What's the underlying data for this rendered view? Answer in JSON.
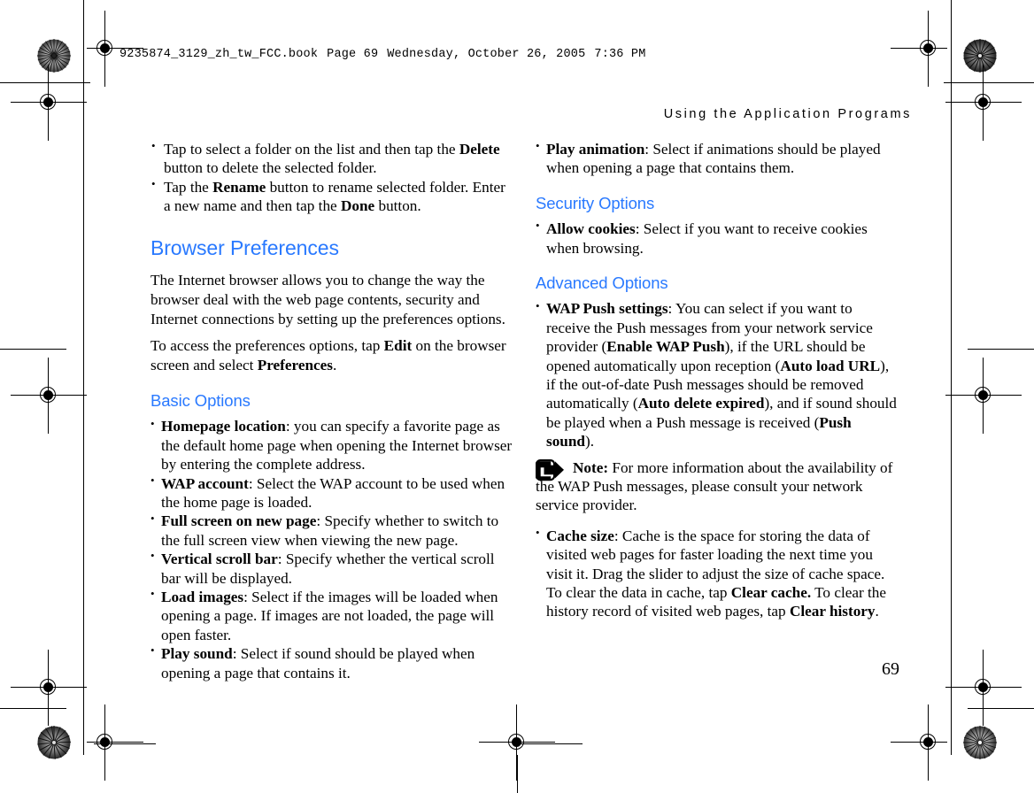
{
  "page": {
    "filestamp_book": "9235874_3129_zh_tw_FCC.book",
    "filestamp_page": "Page 69",
    "filestamp_date": "Wednesday, October 26, 2005",
    "filestamp_time": "7:36 PM",
    "running_head": "Using the Application Programs",
    "folio": "69"
  },
  "left_column": {
    "intro_bullets": [
      {
        "parts": [
          {
            "t": "Tap to select a folder on the list and then tap the ",
            "b": false
          },
          {
            "t": "Delete",
            "b": true
          },
          {
            "t": " button to delete the selected folder.",
            "b": false
          }
        ]
      },
      {
        "parts": [
          {
            "t": "Tap the ",
            "b": false
          },
          {
            "t": "Rename",
            "b": true
          },
          {
            "t": " button to rename selected folder. Enter a new name and then tap the ",
            "b": false
          },
          {
            "t": "Done",
            "b": true
          },
          {
            "t": " button.",
            "b": false
          }
        ]
      }
    ],
    "heading": "Browser Preferences",
    "paragraphs": [
      {
        "parts": [
          {
            "t": "The Internet browser allows you to change the way the browser deal with the web page contents, security and Internet connections by setting up the preferences options.",
            "b": false
          }
        ]
      },
      {
        "parts": [
          {
            "t": "To access the preferences options, tap ",
            "b": false
          },
          {
            "t": "Edit",
            "b": true
          },
          {
            "t": " on the browser screen and select ",
            "b": false
          },
          {
            "t": "Preferences",
            "b": true
          },
          {
            "t": ".",
            "b": false
          }
        ]
      }
    ],
    "subheading": "Basic Options",
    "bullets": [
      {
        "parts": [
          {
            "t": "Homepage location",
            "b": true
          },
          {
            "t": ": you can specify a favorite page as the default home page when opening the Internet browser by entering the complete address.",
            "b": false
          }
        ]
      },
      {
        "parts": [
          {
            "t": "WAP account",
            "b": true
          },
          {
            "t": ": Select the WAP account to be used when the home page is loaded.",
            "b": false
          }
        ]
      },
      {
        "parts": [
          {
            "t": "Full screen on new page",
            "b": true
          },
          {
            "t": ": Specify whether to switch to the full screen view when viewing the new page.",
            "b": false
          }
        ]
      },
      {
        "parts": [
          {
            "t": "Vertical scroll bar",
            "b": true
          },
          {
            "t": ": Specify whether the vertical scroll bar will be displayed.",
            "b": false
          }
        ]
      },
      {
        "parts": [
          {
            "t": "Load images",
            "b": true
          },
          {
            "t": ": Select if the images will be loaded when opening a page. If images are not loaded, the page will open faster.",
            "b": false
          }
        ]
      },
      {
        "parts": [
          {
            "t": "Play sound",
            "b": true
          },
          {
            "t": ": Select if sound should be played when opening a page that contains it.",
            "b": false
          }
        ]
      }
    ]
  },
  "right_column": {
    "top_bullets": [
      {
        "parts": [
          {
            "t": "Play animation",
            "b": true
          },
          {
            "t": ": Select if animations should be played when opening a page that contains them.",
            "b": false
          }
        ]
      }
    ],
    "security_heading": "Security Options",
    "security_bullets": [
      {
        "parts": [
          {
            "t": "Allow cookies",
            "b": true
          },
          {
            "t": ": Select if you want to receive cookies when browsing.",
            "b": false
          }
        ]
      }
    ],
    "advanced_heading": "Advanced Options",
    "advanced_bullets": [
      {
        "parts": [
          {
            "t": "WAP Push settings",
            "b": true
          },
          {
            "t": ": You can select if you want to receive the Push messages from your network service provider (",
            "b": false
          },
          {
            "t": "Enable WAP Push",
            "b": true
          },
          {
            "t": "), if the URL should be opened automatically upon reception (",
            "b": false
          },
          {
            "t": "Auto load URL",
            "b": true
          },
          {
            "t": "), if the out-of-date Push messages should be removed automatically (",
            "b": false
          },
          {
            "t": "Auto delete expired",
            "b": true
          },
          {
            "t": "), and if sound should be played when a Push message is received (",
            "b": false
          },
          {
            "t": "Push sound",
            "b": true
          },
          {
            "t": ").",
            "b": false
          }
        ]
      }
    ],
    "note": {
      "label": "Note:",
      "text": " For more information about the availability of the WAP Push messages, please consult your network service provider."
    },
    "cache_bullets": [
      {
        "parts": [
          {
            "t": "Cache size",
            "b": true
          },
          {
            "t": ": Cache is the space for storing the data of visited web pages for faster loading the next time you visit it. Drag the slider to adjust the size of cache space. To clear the data in cache, tap ",
            "b": false
          },
          {
            "t": "Clear cache.",
            "b": true
          },
          {
            "t": " To clear the history record of visited web pages, tap ",
            "b": false
          },
          {
            "t": "Clear history",
            "b": true
          },
          {
            "t": ".",
            "b": false
          }
        ]
      }
    ]
  },
  "colors": {
    "heading_blue": "#2979ff",
    "body_black": "#000000",
    "paper": "#ffffff"
  }
}
